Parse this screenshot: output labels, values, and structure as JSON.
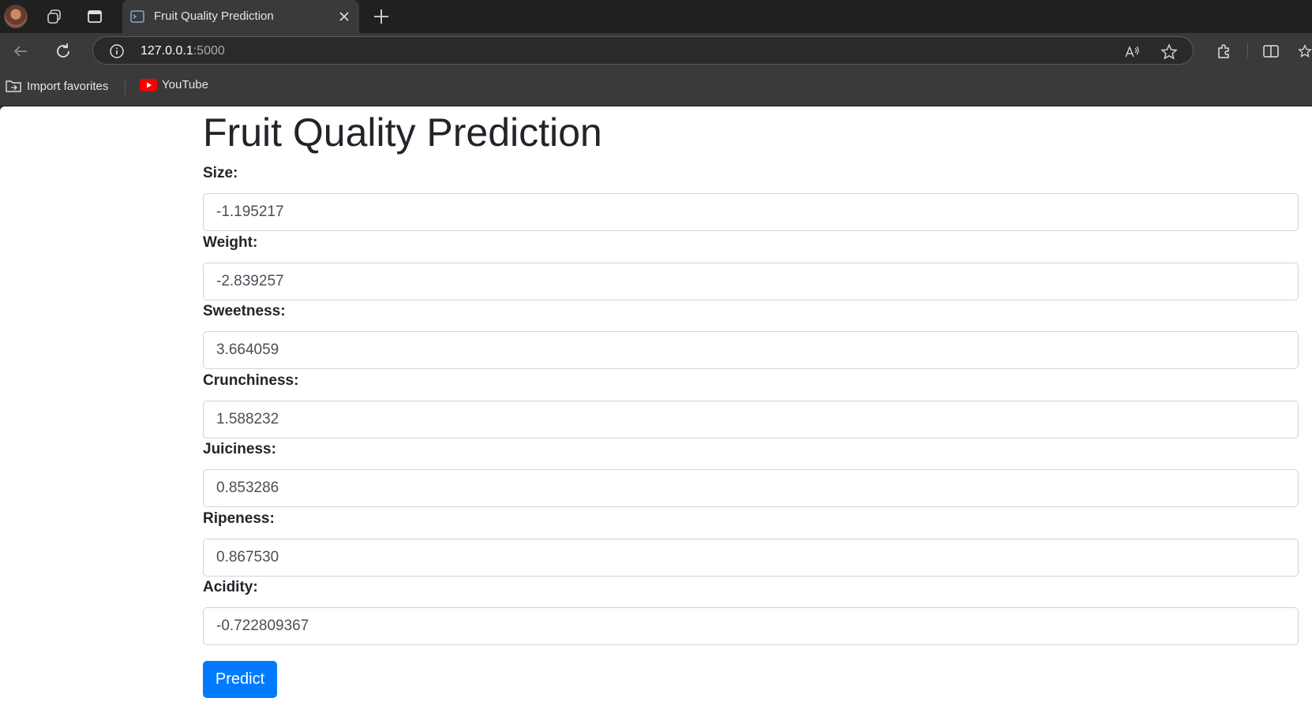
{
  "browser": {
    "tab_title": "Fruit Quality Prediction",
    "url_host": "127.0.0.1",
    "url_port": ":5000",
    "bookmarks": [
      {
        "label": "Import favorites",
        "icon": "import-favorites-icon"
      },
      {
        "label": "YouTube",
        "icon": "youtube-icon"
      }
    ]
  },
  "page": {
    "heading": "Fruit Quality Prediction",
    "fields": [
      {
        "label": "Size:",
        "value": "-1.195217"
      },
      {
        "label": "Weight:",
        "value": "-2.839257"
      },
      {
        "label": "Sweetness:",
        "value": "3.664059"
      },
      {
        "label": "Crunchiness:",
        "value": "1.588232"
      },
      {
        "label": "Juiciness:",
        "value": "0.853286"
      },
      {
        "label": "Ripeness:",
        "value": "0.867530"
      },
      {
        "label": "Acidity:",
        "value": "-0.722809367"
      }
    ],
    "submit_label": "Predict"
  },
  "colors": {
    "primary": "#007bff",
    "text": "#212529",
    "chrome_dark": "#202020",
    "chrome": "#3a3a3a"
  }
}
